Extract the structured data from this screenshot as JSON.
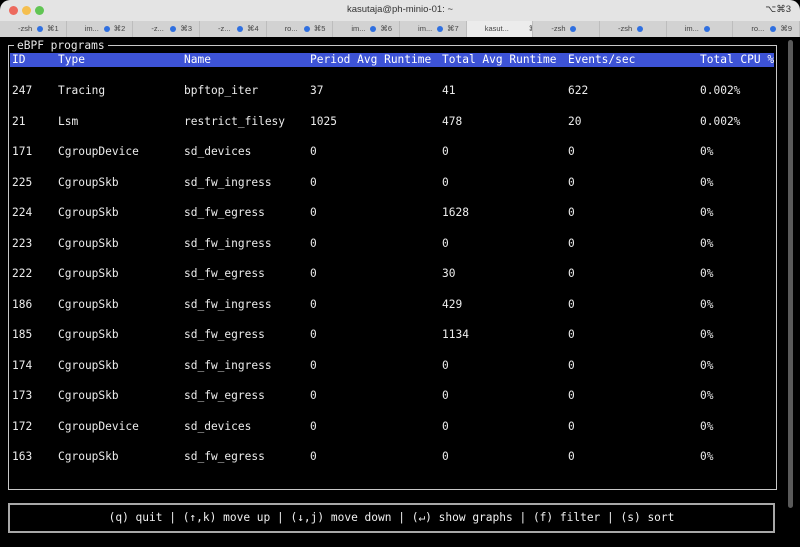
{
  "window": {
    "title": "kasutaja@ph-minio-01: ~",
    "shortcut": "⌥⌘3"
  },
  "tabs": [
    {
      "label": "-zsh",
      "key": "⌘1"
    },
    {
      "label": "im...",
      "key": "⌘2"
    },
    {
      "label": "-z...",
      "key": "⌘3"
    },
    {
      "label": "-z...",
      "key": "⌘4"
    },
    {
      "label": "ro...",
      "key": "⌘5"
    },
    {
      "label": "im...",
      "key": "⌘6"
    },
    {
      "label": "im...",
      "key": "⌘7"
    },
    {
      "label": "kasut...",
      "key": "⌘8",
      "active": true
    },
    {
      "label": "-zsh",
      "key": ""
    },
    {
      "label": "-zsh",
      "key": ""
    },
    {
      "label": "im...",
      "key": ""
    },
    {
      "label": "ro...",
      "key": "⌘9"
    }
  ],
  "colors": {
    "header_bg": "#3d53d6",
    "tab_dot": "#2f6fe0"
  },
  "panel": {
    "title": "eBPF programs"
  },
  "columns": [
    "ID",
    "Type",
    "Name",
    "Period Avg Runtime",
    "Total Avg Runtime",
    "Events/sec",
    "Total CPU %"
  ],
  "rows": [
    {
      "id": "247",
      "type": "Tracing",
      "name": "bpftop_iter",
      "period": "37",
      "total": "41",
      "events": "622",
      "cpu": "0.002%"
    },
    {
      "id": "21",
      "type": "Lsm",
      "name": "restrict_filesy",
      "period": "1025",
      "total": "478",
      "events": "20",
      "cpu": "0.002%"
    },
    {
      "id": "171",
      "type": "CgroupDevice",
      "name": "sd_devices",
      "period": "0",
      "total": "0",
      "events": "0",
      "cpu": "0%"
    },
    {
      "id": "225",
      "type": "CgroupSkb",
      "name": "sd_fw_ingress",
      "period": "0",
      "total": "0",
      "events": "0",
      "cpu": "0%"
    },
    {
      "id": "224",
      "type": "CgroupSkb",
      "name": "sd_fw_egress",
      "period": "0",
      "total": "1628",
      "events": "0",
      "cpu": "0%"
    },
    {
      "id": "223",
      "type": "CgroupSkb",
      "name": "sd_fw_ingress",
      "period": "0",
      "total": "0",
      "events": "0",
      "cpu": "0%"
    },
    {
      "id": "222",
      "type": "CgroupSkb",
      "name": "sd_fw_egress",
      "period": "0",
      "total": "30",
      "events": "0",
      "cpu": "0%"
    },
    {
      "id": "186",
      "type": "CgroupSkb",
      "name": "sd_fw_ingress",
      "period": "0",
      "total": "429",
      "events": "0",
      "cpu": "0%"
    },
    {
      "id": "185",
      "type": "CgroupSkb",
      "name": "sd_fw_egress",
      "period": "0",
      "total": "1134",
      "events": "0",
      "cpu": "0%"
    },
    {
      "id": "174",
      "type": "CgroupSkb",
      "name": "sd_fw_ingress",
      "period": "0",
      "total": "0",
      "events": "0",
      "cpu": "0%"
    },
    {
      "id": "173",
      "type": "CgroupSkb",
      "name": "sd_fw_egress",
      "period": "0",
      "total": "0",
      "events": "0",
      "cpu": "0%"
    },
    {
      "id": "172",
      "type": "CgroupDevice",
      "name": "sd_devices",
      "period": "0",
      "total": "0",
      "events": "0",
      "cpu": "0%"
    },
    {
      "id": "163",
      "type": "CgroupSkb",
      "name": "sd_fw_egress",
      "period": "0",
      "total": "0",
      "events": "0",
      "cpu": "0%"
    }
  ],
  "help": {
    "text": "(q) quit | (↑,k) move up | (↓,j) move down | (↵) show graphs | (f) filter | (s) sort"
  }
}
